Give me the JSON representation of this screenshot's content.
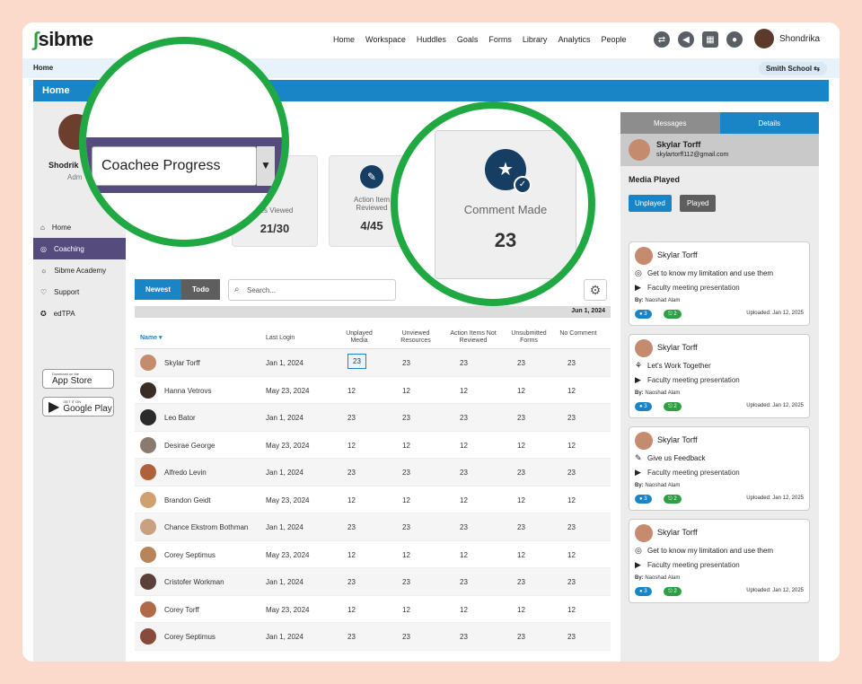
{
  "topbar": {
    "logo": "sibme",
    "nav": [
      "Home",
      "Workspace",
      "Huddles",
      "Goals",
      "Forms",
      "Library",
      "Analytics",
      "People"
    ],
    "user": "Shondrika"
  },
  "breadcrumb": {
    "home": "Home",
    "school": "Smith School"
  },
  "page_title": "Home",
  "sidebar": {
    "user_name": "Shodrik",
    "user_role": "Adm",
    "items": [
      "Home",
      "Coaching",
      "Sibme Academy",
      "Support",
      "edTPA"
    ],
    "app_store": {
      "small": "Download on the",
      "big": "App Store"
    },
    "google_play": {
      "small": "GET IT ON",
      "big": "Google Play"
    }
  },
  "cards": [
    {
      "label": "Resources Viewed",
      "label_visible": "ces Viewed",
      "value": "21/30"
    },
    {
      "label": "Action Items Reviewed",
      "label_line1": "Action Item",
      "label_line2": "Reviewed",
      "value": "4/45"
    }
  ],
  "zoom1": {
    "select": "Coachee Progress"
  },
  "zoom2": {
    "label": "Comment Made",
    "value": "23"
  },
  "filters": {
    "newest": "Newest",
    "todo": "Todo",
    "search_placeholder": "Search...",
    "date": "Jun 1, 2024"
  },
  "table": {
    "headers": [
      "Name",
      "Last Login",
      "Unplayed Media",
      "Unviewed Resources",
      "Action Items Not Reviewed",
      "Unsubmitted Forms",
      "No Comment"
    ],
    "rows": [
      [
        "Skylar Torff",
        "Jan 1, 2024",
        "23",
        "23",
        "23",
        "23",
        "23"
      ],
      [
        "Hanna Vetrovs",
        "May 23, 2024",
        "12",
        "12",
        "12",
        "12",
        "12"
      ],
      [
        "Leo Bator",
        "Jan 1, 2024",
        "23",
        "23",
        "23",
        "23",
        "23"
      ],
      [
        "Desirae George",
        "May 23, 2024",
        "12",
        "12",
        "12",
        "12",
        "12"
      ],
      [
        "Alfredo Levin",
        "Jan 1, 2024",
        "23",
        "23",
        "23",
        "23",
        "23"
      ],
      [
        "Brandon Geidt",
        "May 23, 2024",
        "12",
        "12",
        "12",
        "12",
        "12"
      ],
      [
        "Chance Ekstrom Bothman",
        "Jan 1, 2024",
        "23",
        "23",
        "23",
        "23",
        "23"
      ],
      [
        "Corey Septimus",
        "May 23, 2024",
        "12",
        "12",
        "12",
        "12",
        "12"
      ],
      [
        "Cristofer Workman",
        "Jan 1, 2024",
        "23",
        "23",
        "23",
        "23",
        "23"
      ],
      [
        "Corey Torff",
        "May 23, 2024",
        "12",
        "12",
        "12",
        "12",
        "12"
      ],
      [
        "Corey Septimus",
        "Jan 1, 2024",
        "23",
        "23",
        "23",
        "23",
        "23"
      ]
    ]
  },
  "right": {
    "tabs": [
      "Messages",
      "Details"
    ],
    "user": "Skylar Torff",
    "email": "skylartorff112@gmail.com",
    "media_title": "Media Played",
    "btn_unplayed": "Unplayed",
    "btn_played": "Played",
    "items": [
      {
        "name": "Skylar Torff",
        "title": "Get to know my limitation and use them",
        "sub": "Faculty meeting presentation",
        "by_label": "By:",
        "by": "Naoshad Alam",
        "c1": "3",
        "c2": "2",
        "up": "Uploaded: Jan 12, 2025"
      },
      {
        "name": "Skylar Torff",
        "title": "Let's Work Together",
        "sub": "Faculty meeting presentation",
        "by_label": "By:",
        "by": "Naoshad Alam",
        "c1": "3",
        "c2": "2",
        "up": "Uploaded: Jan 12, 2025"
      },
      {
        "name": "Skylar Torff",
        "title": "Give us Feedback",
        "sub": "Faculty meeting presentation",
        "by_label": "By:",
        "by": "Naoshad Alam",
        "c1": "3",
        "c2": "2",
        "up": "Uploaded: Jan 12, 2025"
      },
      {
        "name": "Skylar Torff",
        "title": "Get to know my limitation and use them",
        "sub": "Faculty meeting presentation",
        "by_label": "By:",
        "by": "Naoshad Alam",
        "c1": "3",
        "c2": "2",
        "up": "Uploaded: Jan 12, 2025"
      }
    ]
  }
}
